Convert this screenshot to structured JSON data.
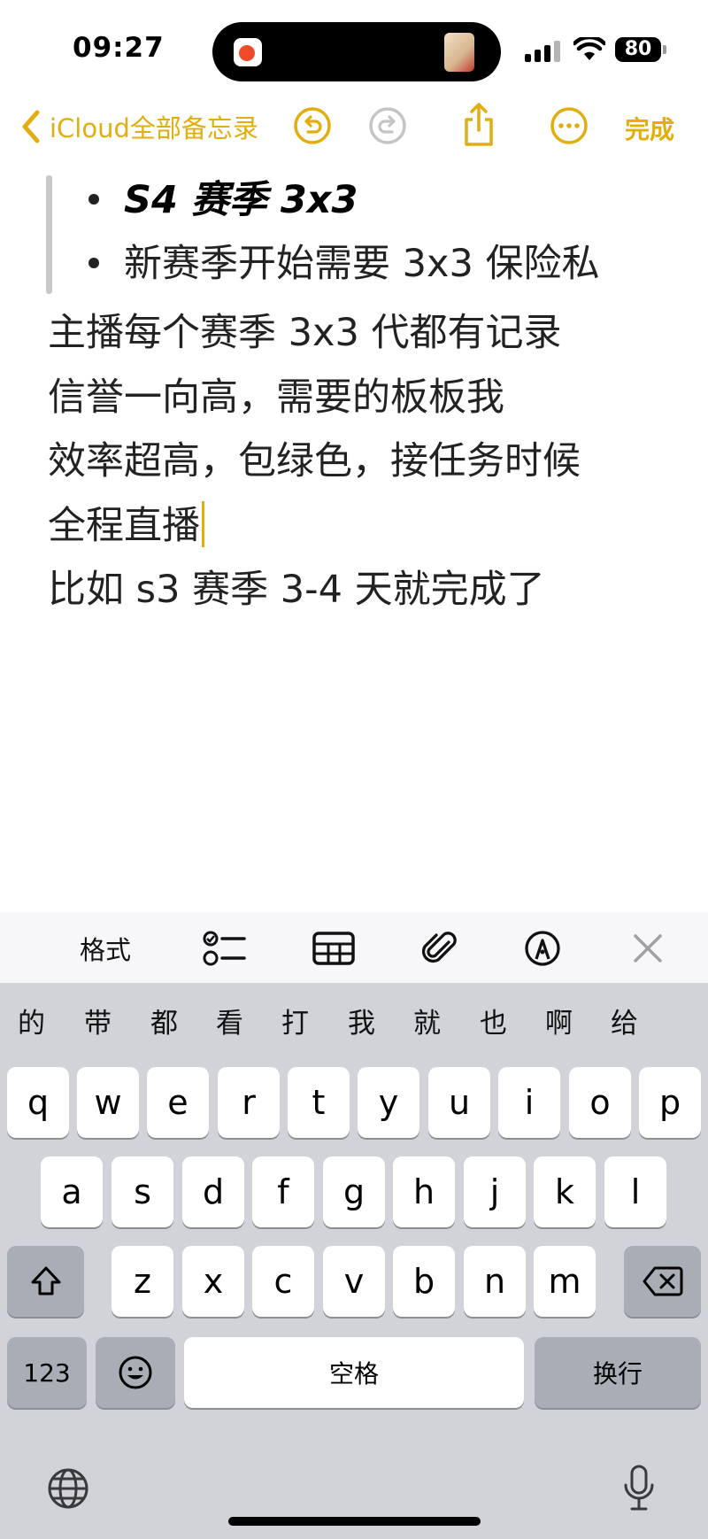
{
  "status_bar": {
    "time": "09:27",
    "battery": "80"
  },
  "toolbar": {
    "back_label": "iCloud全部备忘录",
    "done_label": "完成",
    "accent": "#e2ae0f"
  },
  "note": {
    "bullets": [
      "S4 赛季 3x3",
      "新赛季开始需要 3x3 保险私"
    ],
    "lines": [
      "主播每个赛季 3x3 代都有记录",
      "信誉一向高，需要的板板我",
      "效率超高，包绿色，接任务时候",
      "全程直播",
      "比如 s3 赛季 3-4 天就完成了"
    ]
  },
  "format_bar": {
    "format_label": "格式"
  },
  "keyboard": {
    "candidates": [
      "的",
      "带",
      "都",
      "看",
      "打",
      "我",
      "就",
      "也",
      "啊",
      "给"
    ],
    "row1": [
      "q",
      "w",
      "e",
      "r",
      "t",
      "y",
      "u",
      "i",
      "o",
      "p"
    ],
    "row2": [
      "a",
      "s",
      "d",
      "f",
      "g",
      "h",
      "j",
      "k",
      "l"
    ],
    "row3": [
      "z",
      "x",
      "c",
      "v",
      "b",
      "n",
      "m"
    ],
    "numbers_label": "123",
    "space_label": "空格",
    "return_label": "换行"
  }
}
